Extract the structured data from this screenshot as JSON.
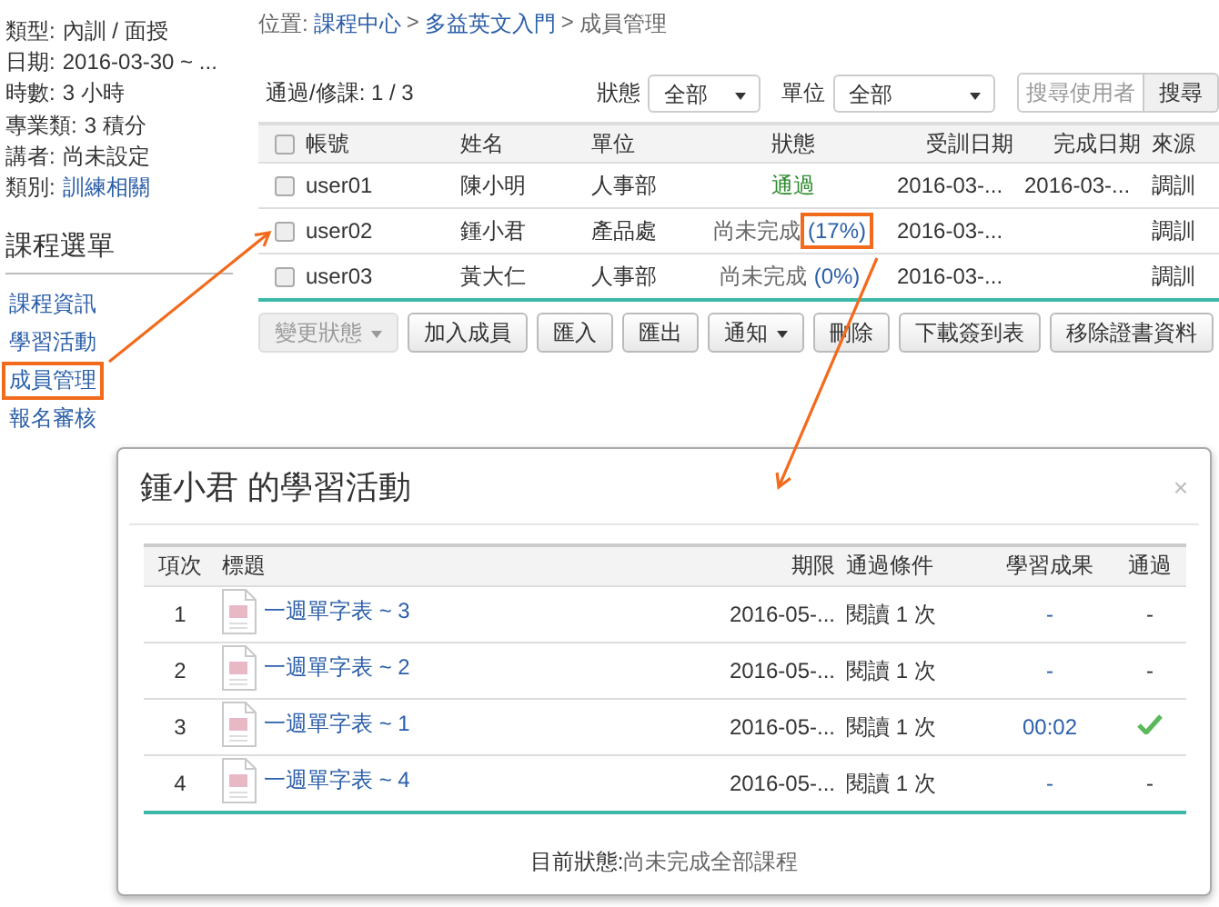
{
  "course_info": [
    {
      "label": "類型:",
      "value": "內訓 / 面授",
      "link": false
    },
    {
      "label": "日期:",
      "value": "2016-03-30 ~ ...",
      "link": false
    },
    {
      "label": "時數:",
      "value": "3 小時",
      "link": false
    },
    {
      "label": "專業類:",
      "value": "3 積分",
      "link": false
    },
    {
      "label": "講者:",
      "value": "尚未設定",
      "link": false
    },
    {
      "label": "類別:",
      "value": "訓練相關",
      "link": true
    }
  ],
  "menu": {
    "title": "課程選單",
    "items": [
      {
        "label": "課程資訊",
        "highlighted": false
      },
      {
        "label": "學習活動",
        "highlighted": false
      },
      {
        "label": "成員管理",
        "highlighted": true
      },
      {
        "label": "報名審核",
        "highlighted": false
      }
    ]
  },
  "breadcrumb": {
    "label": "位置:",
    "links": [
      "課程中心",
      "多益英文入門"
    ],
    "separators": [
      ">",
      ">"
    ],
    "current": "成員管理"
  },
  "toolbar": {
    "summary": "通過/修課: 1 / 3",
    "status_label": "狀態",
    "status_value": "全部",
    "unit_label": "單位",
    "unit_value": "全部",
    "search_placeholder": "搜尋使用者",
    "search_button": "搜尋"
  },
  "members": {
    "all_checked": false,
    "columns": [
      "帳號",
      "姓名",
      "單位",
      "狀態",
      "受訓日期",
      "完成日期",
      "來源"
    ],
    "rows": [
      {
        "account": "user01",
        "name": "陳小明",
        "unit": "人事部",
        "passed": true,
        "status": "通過",
        "start": "2016-03-...",
        "end": "2016-03-...",
        "source": "調訓",
        "checked": false
      },
      {
        "account": "user02",
        "name": "鍾小君",
        "unit": "產品處",
        "passed": false,
        "status": "尚未完成",
        "progress": "(17%)",
        "progress_highlighted": true,
        "start": "2016-03-...",
        "source": "調訓",
        "checked": false
      },
      {
        "account": "user03",
        "name": "黃大仁",
        "unit": "人事部",
        "passed": false,
        "status": "尚未完成",
        "progress": "(0%)",
        "progress_highlighted": false,
        "start": "2016-03-...",
        "source": "調訓",
        "checked": false
      }
    ]
  },
  "actions": [
    {
      "label": "變更狀態",
      "dropdown": true,
      "disabled": true
    },
    {
      "label": "加入成員",
      "dropdown": false,
      "disabled": false
    },
    {
      "label": "匯入",
      "dropdown": false,
      "disabled": false
    },
    {
      "label": "匯出",
      "dropdown": false,
      "disabled": false
    },
    {
      "label": "通知",
      "dropdown": true,
      "disabled": false
    },
    {
      "label": "刪除",
      "dropdown": false,
      "disabled": false
    },
    {
      "label": "下載簽到表",
      "dropdown": false,
      "disabled": false
    },
    {
      "label": "移除證書資料",
      "dropdown": false,
      "disabled": false
    }
  ],
  "dialog": {
    "title": "鍾小君 的學習活動",
    "close": "×",
    "columns": [
      "項次",
      "標題",
      "期限",
      "通過條件",
      "學習成果",
      "通過"
    ],
    "rows": [
      {
        "index": "1",
        "title": "一週單字表 ~ 3",
        "deadline": "2016-05-...",
        "condition": "閱讀 1 次",
        "result": "-",
        "passed": false
      },
      {
        "index": "2",
        "title": "一週單字表 ~ 2",
        "deadline": "2016-05-...",
        "condition": "閱讀 1 次",
        "result": "-",
        "passed": false
      },
      {
        "index": "3",
        "title": "一週單字表 ~ 1",
        "deadline": "2016-05-...",
        "condition": "閱讀 1 次",
        "result": "00:02",
        "passed": true
      },
      {
        "index": "4",
        "title": "一週單字表 ~ 4",
        "deadline": "2016-05-...",
        "condition": "閱讀 1 次",
        "result": "-",
        "passed": false
      }
    ],
    "not_passed_mark": "-",
    "footer_label": "目前狀態:",
    "footer_value": "尚未完成全部課程"
  }
}
